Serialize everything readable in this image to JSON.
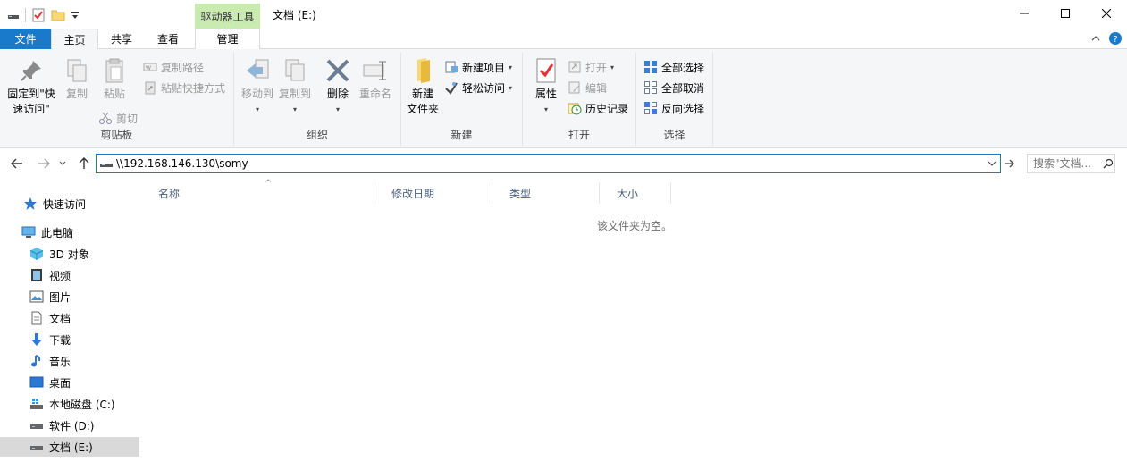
{
  "window": {
    "title": "文档 (E:)",
    "context_tab_header": "驱动器工具",
    "minimize_icon": "minimize-icon",
    "maximize_icon": "maximize-icon",
    "close_icon": "close-icon"
  },
  "tabs": {
    "file": "文件",
    "home": "主页",
    "share": "共享",
    "view": "查看",
    "manage": "管理"
  },
  "ribbon": {
    "clipboard": {
      "label": "剪贴板",
      "pin_line1": "固定到\"快",
      "pin_line2": "速访问\"",
      "copy": "复制",
      "paste": "粘贴",
      "copy_path": "复制路径",
      "paste_shortcut": "粘贴快捷方式",
      "cut": "剪切"
    },
    "organize": {
      "label": "组织",
      "move_to": "移动到",
      "copy_to": "复制到",
      "delete": "删除",
      "rename": "重命名"
    },
    "new": {
      "label": "新建",
      "new_folder_line1": "新建",
      "new_folder_line2": "文件夹",
      "new_item": "新建项目",
      "easy_access": "轻松访问"
    },
    "open": {
      "label": "打开",
      "properties": "属性",
      "open": "打开",
      "edit": "编辑",
      "history": "历史记录"
    },
    "select": {
      "label": "选择",
      "select_all": "全部选择",
      "select_none": "全部取消",
      "invert": "反向选择"
    }
  },
  "address": {
    "value": "\\\\192.168.146.130\\somy",
    "search_placeholder": "搜索\"文档..."
  },
  "navpane": {
    "quick_access": "快速访问",
    "this_pc": "此电脑",
    "objects3d": "3D 对象",
    "videos": "视频",
    "pictures": "图片",
    "documents": "文档",
    "downloads": "下载",
    "music": "音乐",
    "desktop": "桌面",
    "drive_c": "本地磁盘 (C:)",
    "drive_d": "软件 (D:)",
    "drive_e": "文档 (E:)"
  },
  "content": {
    "columns": [
      "名称",
      "修改日期",
      "类型",
      "大小"
    ],
    "empty_message": "该文件夹为空。"
  },
  "colors": {
    "accent": "#1979ca",
    "context_tab": "#c9eab0",
    "ribbon_bg": "#f5f6f7",
    "selected_nav": "#d9d9d9"
  }
}
